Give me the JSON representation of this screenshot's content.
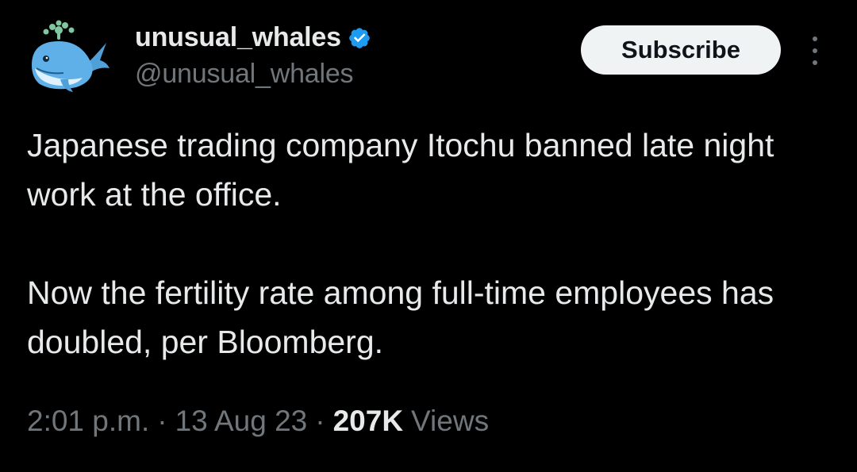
{
  "author": {
    "display_name": "unusual_whales",
    "handle": "@unusual_whales",
    "verified_icon": "verified-badge-icon",
    "avatar_icon": "whale-avatar-icon"
  },
  "actions": {
    "subscribe_label": "Subscribe",
    "more_icon": "more-vertical-icon"
  },
  "tweet": {
    "paragraph_1": "Japanese trading company Itochu banned late night work at the office.",
    "paragraph_2": "Now the fertility rate among full-time employees has doubled, per Bloomberg."
  },
  "meta": {
    "time": "2:01 p.m.",
    "separator": "·",
    "date": "13 Aug 23",
    "views_count": "207K",
    "views_label": "Views"
  },
  "colors": {
    "background": "#000000",
    "text_primary": "#e7e9ea",
    "text_secondary": "#71767b",
    "verified_blue": "#1d9bf0",
    "button_bg": "#eff3f4"
  }
}
